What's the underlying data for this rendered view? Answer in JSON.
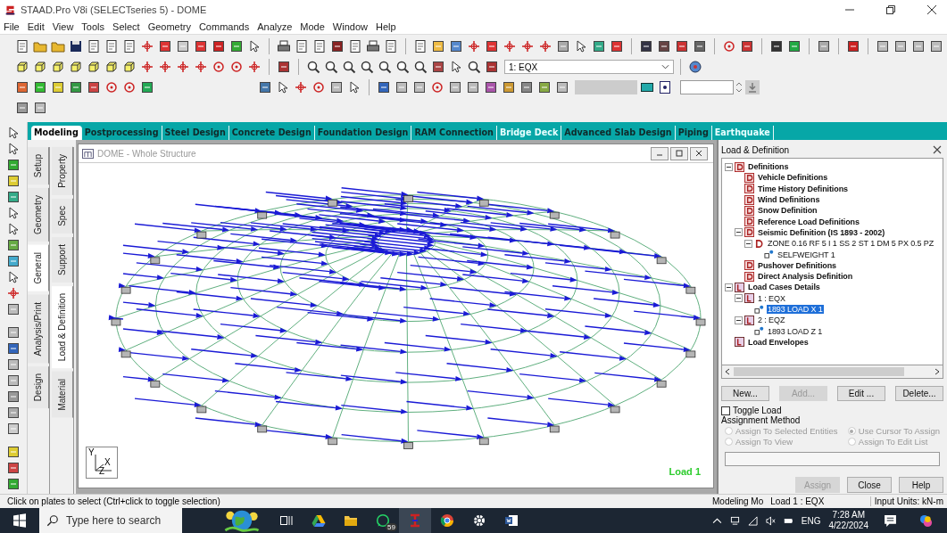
{
  "window": {
    "title": "STAAD.Pro V8i (SELECTseries 5) - DOME"
  },
  "menu": [
    "File",
    "Edit",
    "View",
    "Tools",
    "Select",
    "Geometry",
    "Commands",
    "Analyze",
    "Mode",
    "Window",
    "Help"
  ],
  "toolbar": {
    "load_case_dropdown": "1: EQX"
  },
  "module_tabs": [
    {
      "label": "Modeling",
      "selected": true,
      "disabled": false
    },
    {
      "label": "Postprocessing",
      "selected": false,
      "disabled": false
    },
    {
      "label": "Steel Design",
      "selected": false,
      "disabled": false
    },
    {
      "label": "Concrete Design",
      "selected": false,
      "disabled": false
    },
    {
      "label": "Foundation Design",
      "selected": false,
      "disabled": false
    },
    {
      "label": "RAM Connection",
      "selected": false,
      "disabled": false
    },
    {
      "label": "Bridge Deck",
      "selected": false,
      "disabled": true
    },
    {
      "label": "Advanced Slab Design",
      "selected": false,
      "disabled": false
    },
    {
      "label": "Piping",
      "selected": false,
      "disabled": false
    },
    {
      "label": "Earthquake",
      "selected": false,
      "disabled": true
    }
  ],
  "side_tabs": {
    "outer": [
      {
        "label": "Setup",
        "selected": false
      },
      {
        "label": "Geometry",
        "selected": false
      },
      {
        "label": "General",
        "selected": true
      },
      {
        "label": "Analysis/Print",
        "selected": false
      },
      {
        "label": "Design",
        "selected": false
      }
    ],
    "inner": [
      {
        "label": "Property",
        "selected": false
      },
      {
        "label": "Spec",
        "selected": false
      },
      {
        "label": "Support",
        "selected": false
      },
      {
        "label": "Load & Definition",
        "selected": true
      },
      {
        "label": "Material",
        "selected": false
      }
    ]
  },
  "viewport": {
    "title": "DOME - Whole Structure",
    "load_label": "Load 1",
    "axis_labels": [
      "Y",
      "X",
      "Z"
    ]
  },
  "load_panel": {
    "title": "Load & Definition",
    "tree": [
      {
        "label": "Definitions",
        "kind": "definition",
        "selected": false,
        "expanded": true,
        "children": [
          {
            "label": "Vehicle Definitions",
            "kind": "definition",
            "selected": false
          },
          {
            "label": "Time History Definitions",
            "kind": "definition",
            "selected": false
          },
          {
            "label": "Wind Definitions",
            "kind": "definition",
            "selected": false
          },
          {
            "label": "Snow Definition",
            "kind": "definition",
            "selected": false
          },
          {
            "label": "Reference Load Definitions",
            "kind": "definition",
            "selected": false
          },
          {
            "label": "Seismic Definition (IS 1893 - 2002)",
            "kind": "definition",
            "selected": false,
            "expanded": true,
            "children": [
              {
                "label": "ZONE 0.16 RF 5 I 1 SS 2 ST 1 DM 5 PX 0.5 PZ",
                "kind": "parameter",
                "selected": false,
                "expanded": true,
                "children": [
                  {
                    "label": "SELFWEIGHT 1",
                    "kind": "load",
                    "selected": false
                  }
                ]
              }
            ]
          },
          {
            "label": "Pushover Definitions",
            "kind": "definition",
            "selected": false
          },
          {
            "label": "Direct Analysis Definition",
            "kind": "definition",
            "selected": false
          }
        ]
      },
      {
        "label": "Load Cases Details",
        "kind": "load-case",
        "selected": false,
        "expanded": true,
        "children": [
          {
            "label": "1 : EQX",
            "kind": "load-case",
            "selected": false,
            "expanded": true,
            "children": [
              {
                "label": "1893 LOAD X 1",
                "kind": "load",
                "selected": true
              }
            ]
          },
          {
            "label": "2 : EQZ",
            "kind": "load-case",
            "selected": false,
            "expanded": true,
            "children": [
              {
                "label": "1893 LOAD Z 1",
                "kind": "load",
                "selected": false
              }
            ]
          }
        ]
      },
      {
        "label": "Load Envelopes",
        "kind": "load-case",
        "selected": false
      }
    ],
    "buttons": [
      {
        "label": "New...",
        "disabled": false
      },
      {
        "label": "Add...",
        "disabled": true
      },
      {
        "label": "Edit ...",
        "disabled": false
      },
      {
        "label": "Delete...",
        "disabled": false
      }
    ],
    "toggle_load": {
      "label": "Toggle Load",
      "checked": false
    },
    "assignment_method": {
      "title": "Assignment Method",
      "disabled": true,
      "options": [
        {
          "label": "Assign To Selected Entities",
          "selected": false
        },
        {
          "label": "Use Cursor To Assign",
          "selected": true
        },
        {
          "label": "Assign To View",
          "selected": false
        },
        {
          "label": "Assign To Edit List",
          "selected": false
        }
      ]
    },
    "footer_buttons": [
      {
        "label": "Assign",
        "disabled": true
      },
      {
        "label": "Close",
        "disabled": false
      },
      {
        "label": "Help",
        "disabled": false
      }
    ]
  },
  "status_bar": {
    "message": "Click on plates to select (Ctrl+click to toggle selection)",
    "mode": "Modeling Mo",
    "load": "Load 1 : EQX",
    "units": "Input Units:  kN-m"
  },
  "taskbar": {
    "search_placeholder": "Type here to search",
    "chat_badge": "59",
    "language": "ENG",
    "time": "7:28 AM",
    "date": "4/22/2024"
  }
}
